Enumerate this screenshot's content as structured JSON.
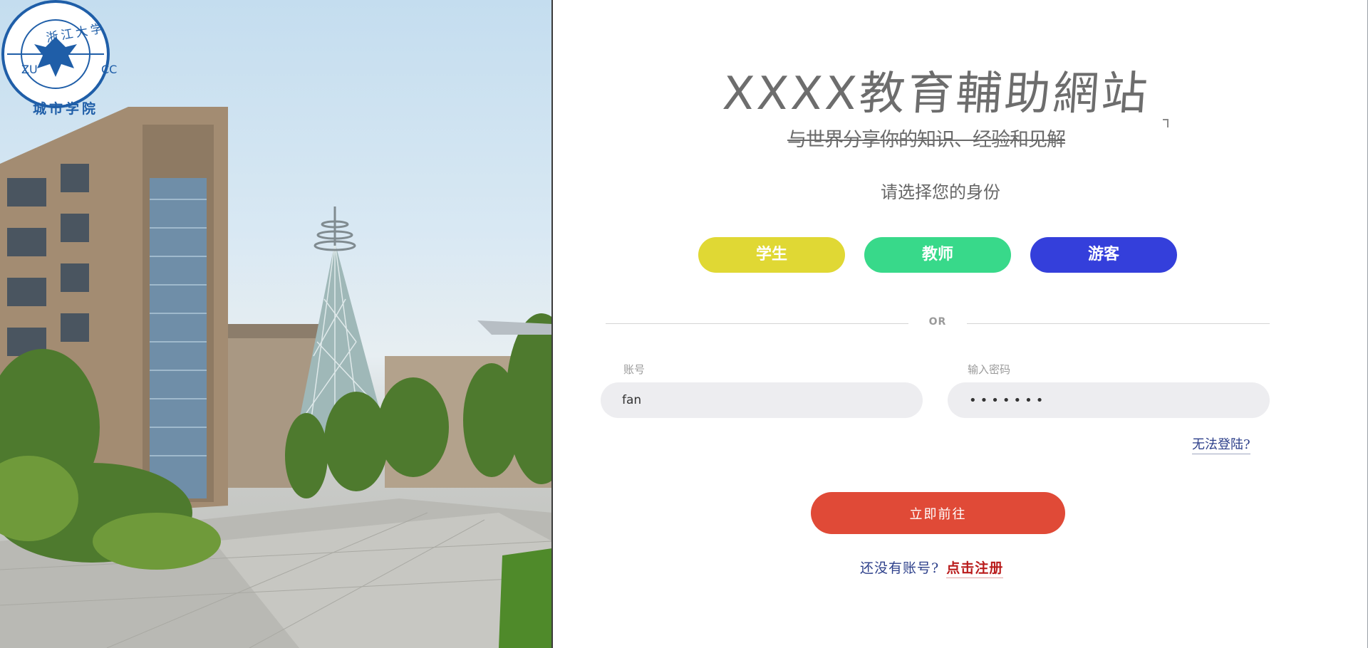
{
  "logo": {
    "top_text": "浙江大学",
    "bottom_text": "城市学院",
    "left_text": "ZU",
    "right_text": "CC",
    "color": "#1f5ea8"
  },
  "header": {
    "title": "XXXX教育輔助網站",
    "tagline": "与世界分享你的知识、经验和见解"
  },
  "identity": {
    "prompt": "请选择您的身份",
    "roles": [
      {
        "label": "学生",
        "color": "#e0d834"
      },
      {
        "label": "教师",
        "color": "#38d98a"
      },
      {
        "label": "游客",
        "color": "#343fdb"
      }
    ]
  },
  "divider": {
    "text": "OR"
  },
  "form": {
    "account_label": "账号",
    "account_value": "fan",
    "password_label": "输入密码",
    "password_value": "•••••••",
    "forgot_link": "无法登陆?",
    "submit_label": "立即前往"
  },
  "register": {
    "prompt": "还没有账号?",
    "link": "点击注册"
  },
  "colors": {
    "submit": "#e04a37",
    "link_blue": "#2c3f8a",
    "link_red": "#b91b1b"
  }
}
